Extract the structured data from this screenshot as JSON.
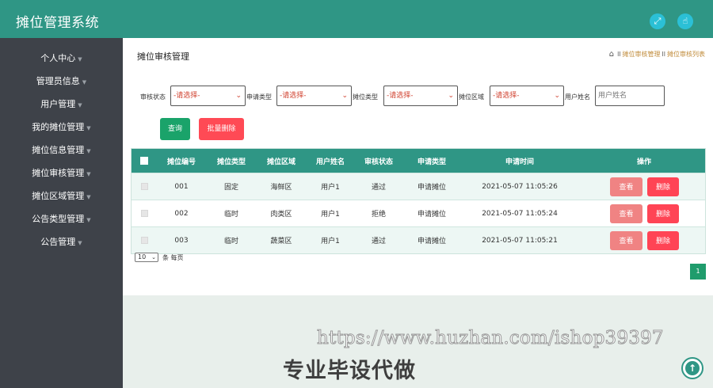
{
  "app": {
    "title": "摊位管理系统"
  },
  "header": {
    "fullscreen_icon": "fullscreen-icon",
    "pointer_icon": "hand-pointer-icon"
  },
  "sidebar": {
    "items": [
      {
        "label": "个人中心"
      },
      {
        "label": "管理员信息"
      },
      {
        "label": "用户管理"
      },
      {
        "label": "我的摊位管理"
      },
      {
        "label": "摊位信息管理"
      },
      {
        "label": "摊位审核管理"
      },
      {
        "label": "摊位区域管理"
      },
      {
        "label": "公告类型管理"
      },
      {
        "label": "公告管理"
      }
    ]
  },
  "page": {
    "title": "摊位审核管理",
    "breadcrumbs": [
      "摊位审核管理",
      "摊位审核列表"
    ]
  },
  "filters": {
    "audit_status_label": "审核状态",
    "apply_type_label": "申请类型",
    "booth_type_label": "摊位类型",
    "booth_area_label": "摊位区域",
    "username_label": "用户姓名",
    "select_placeholder": "-请选择-",
    "username_placeholder": "用户姓名",
    "query_label": "查询",
    "batch_delete_label": "批量删除"
  },
  "table": {
    "headers": [
      "摊位编号",
      "摊位类型",
      "摊位区域",
      "用户姓名",
      "审核状态",
      "申请类型",
      "申请时间",
      "操作"
    ],
    "rows": [
      {
        "code": "001",
        "type": "固定",
        "area": "海鲜区",
        "user": "用户1",
        "status": "通过",
        "apply": "申请摊位",
        "time": "2021-05-07 11:05:26"
      },
      {
        "code": "002",
        "type": "临时",
        "area": "肉类区",
        "user": "用户1",
        "status": "拒绝",
        "apply": "申请摊位",
        "time": "2021-05-07 11:05:24"
      },
      {
        "code": "003",
        "type": "临时",
        "area": "蔬菜区",
        "user": "用户1",
        "status": "通过",
        "apply": "申请摊位",
        "time": "2021-05-07 11:05:21"
      }
    ],
    "view_label": "查看",
    "delete_label": "删除"
  },
  "pagination": {
    "page_size": "10",
    "page_size_label": "条 每页",
    "current_page": "1"
  },
  "watermark": {
    "url": "https://www.huzhan.com/ishop39397",
    "slogan": "专业毕设代做"
  },
  "colors": {
    "primary": "#2f9685",
    "sidebar": "#3e4249",
    "danger": "#ff4455",
    "success": "#1aa36a"
  }
}
